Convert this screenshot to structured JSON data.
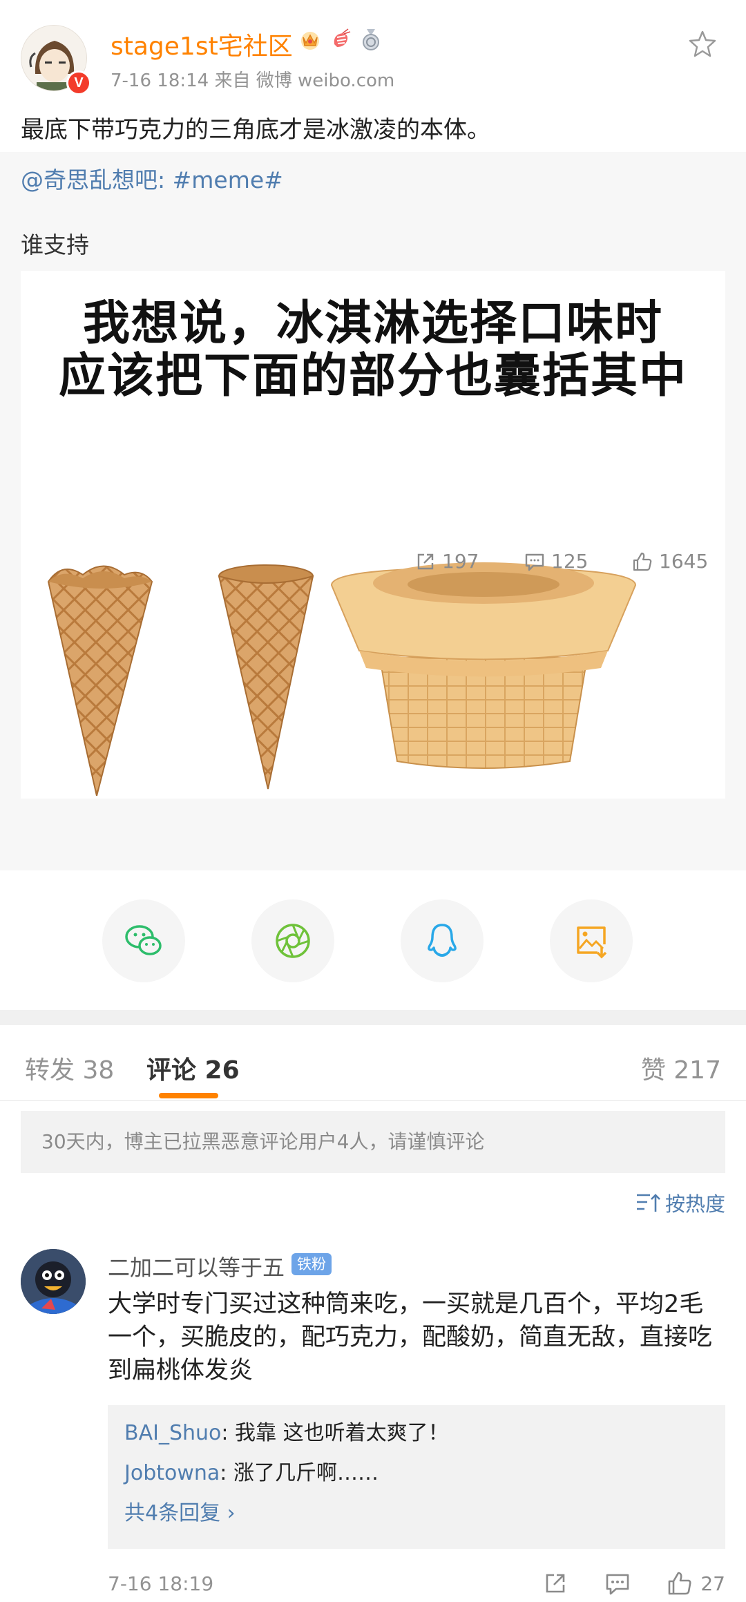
{
  "post": {
    "user_name": "stage1st宅社区",
    "meta": "7-16 18:14  来自 微博 weibo.com",
    "text": "最底下带巧克力的三角底才是冰激凌的本体。"
  },
  "retweet": {
    "source": "@奇思乱想吧: #meme#",
    "text": "谁支持",
    "image_text_line1": "我想说，冰淇淋选择口味时",
    "image_text_line2": "应该把下面的部分也囊括其中",
    "reposts": "197",
    "comments": "125",
    "likes": "1645"
  },
  "share": {
    "icons": [
      "wechat-icon",
      "moments-icon",
      "qq-icon",
      "save-image-icon"
    ],
    "colors": {
      "wechat": "#2dbd6b",
      "moments": "#6fc23a",
      "qq": "#29a8e8",
      "save": "#f5a623"
    }
  },
  "tabs": {
    "repost": "转发 38",
    "comment": "评论 26",
    "like": "赞 217"
  },
  "notice": "30天内，博主已拉黑恶意评论用户4人，请谨慎评论",
  "sort_label": "按热度",
  "comment": {
    "user": "二加二可以等于五",
    "badge": "铁粉",
    "text": "大学时专门买过这种筒来吃，一买就是几百个，平均2毛一个，买脆皮的，配巧克力，配酸奶，简直无敌，直接吃到扁桃体发炎",
    "replies": [
      {
        "user": "BAI_Shuo",
        "text": ": 我靠 这也听着太爽了！"
      },
      {
        "user": "Jobtowna",
        "text": ": 涨了几斤啊……"
      }
    ],
    "more_replies": "共4条回复 ›",
    "time": "7-16 18:19",
    "likes": "27"
  },
  "colors": {
    "accent_orange": "#ff8200",
    "link_blue": "#507daf"
  }
}
